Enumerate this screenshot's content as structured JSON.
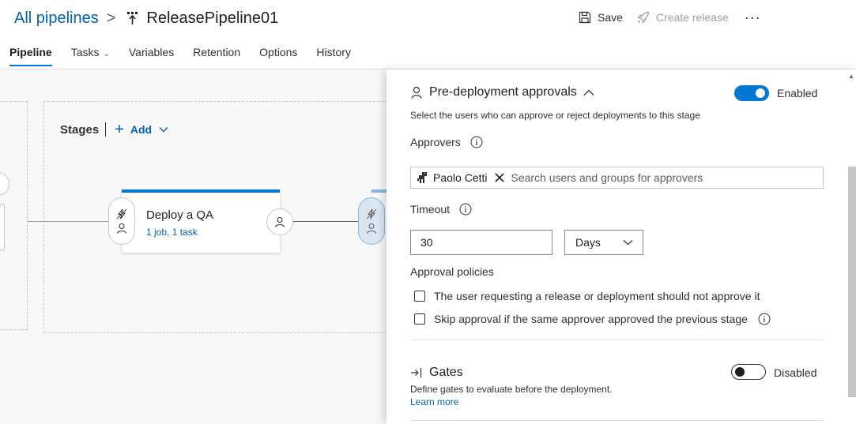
{
  "header": {
    "breadcrumb_root": "All pipelines",
    "breadcrumb_sep": ">",
    "pipeline_name": "ReleasePipeline01",
    "save_label": "Save",
    "create_release_label": "Create release",
    "more_label": "···"
  },
  "tabs": [
    {
      "label": "Pipeline",
      "active": true
    },
    {
      "label": "Tasks",
      "dropdown": true
    },
    {
      "label": "Variables"
    },
    {
      "label": "Retention"
    },
    {
      "label": "Options"
    },
    {
      "label": "History"
    }
  ],
  "canvas": {
    "stages_label": "Stages",
    "add_label": "Add",
    "stage": {
      "name": "Deploy a QA",
      "summary": "1 job, 1 task"
    }
  },
  "panel": {
    "pre_deployment": {
      "title": "Pre-deployment approvals",
      "toggle_label": "Enabled",
      "enabled": true,
      "description": "Select the users who can approve or reject deployments to this stage",
      "approvers_label": "Approvers",
      "approvers": [
        "Paolo Cetti"
      ],
      "approvers_placeholder": "Search users and groups for approvers",
      "timeout_label": "Timeout",
      "timeout_value": "30",
      "timeout_unit": "Days",
      "policies_label": "Approval policies",
      "policies": [
        {
          "label": "The user requesting a release or deployment should not approve it",
          "checked": false
        },
        {
          "label": "Skip approval if the same approver approved the previous stage",
          "checked": false
        }
      ]
    },
    "gates": {
      "title": "Gates",
      "toggle_label": "Disabled",
      "enabled": false,
      "description": "Define gates to evaluate before the deployment.",
      "learn_more": "Learn more"
    }
  },
  "colors": {
    "accent": "#0078d4",
    "link": "#0063b1",
    "text": "#323130",
    "disabled_text": "#a19f9d"
  }
}
